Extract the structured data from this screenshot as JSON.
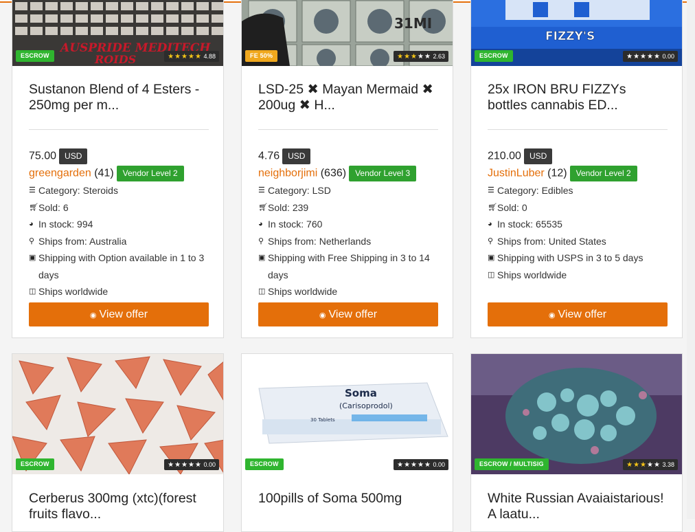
{
  "ui": {
    "label_category": "Category:",
    "label_sold": "Sold:",
    "label_stock": "In stock:",
    "label_ships_from": "Ships from:",
    "label_worldwide": "Ships worldwide",
    "view_offer": "View offer",
    "accent_color": "#e46f0a",
    "escrow_color": "#2fb52f"
  },
  "listings": [
    {
      "badge": "ESCROW",
      "image_text_1": "AUSPRIDE MEDITECH",
      "image_text_2": "ROIDS",
      "rating_value": "4.88",
      "rating": 4.88,
      "title": "Sustanon Blend of 4 Esters - 250mg per m...",
      "price": "75.00",
      "currency": "USD",
      "vendor": "greengarden",
      "vendor_count": "(41)",
      "vendor_level": "Vendor Level 2",
      "category": "Steroids",
      "sold": "6",
      "in_stock": "994",
      "ships_from": "Australia",
      "shipping": "Shipping with Option available in 1 to 3 days"
    },
    {
      "badge": "FE 50%",
      "image_text_1": "31MI",
      "rating_value": "2.63",
      "rating": 2.63,
      "title": "LSD-25 ✖ Mayan Mermaid ✖ 200ug ✖ H...",
      "price": "4.76",
      "currency": "USD",
      "vendor": "neighborjimi",
      "vendor_count": "(636)",
      "vendor_level": "Vendor Level 3",
      "category": "LSD",
      "sold": "239",
      "in_stock": "760",
      "ships_from": "Netherlands",
      "shipping": "Shipping with Free Shipping in 3 to 14 days"
    },
    {
      "badge": "ESCROW",
      "image_text_1": "FIZZY'S",
      "rating_value": "0.00",
      "rating": 0,
      "title": "25x IRON BRU FIZZYs bottles cannabis ED...",
      "price": "210.00",
      "currency": "USD",
      "vendor": "JustinLuber",
      "vendor_count": "(12)",
      "vendor_level": "Vendor Level 2",
      "category": "Edibles",
      "sold": "0",
      "in_stock": "65535",
      "ships_from": "United States",
      "shipping": "Shipping with USPS in 3 to 5 days"
    },
    {
      "badge": "ESCROW",
      "rating_value": "0.00",
      "rating": 0,
      "title": "Cerberus 300mg (xtc)(forest fruits flavo..."
    },
    {
      "badge": "ESCROW",
      "image_text_1": "Soma",
      "image_text_2": "(Carisoprodol)",
      "image_text_3": "30 Tablets",
      "rating_value": "0.00",
      "rating": 0,
      "title": "100pills of Soma 500mg"
    },
    {
      "badge": "ESCROW / MULTISIG",
      "rating_value": "3.38",
      "rating": 3.38,
      "title": "White Russian Avaiaistarious! A laatu..."
    }
  ]
}
